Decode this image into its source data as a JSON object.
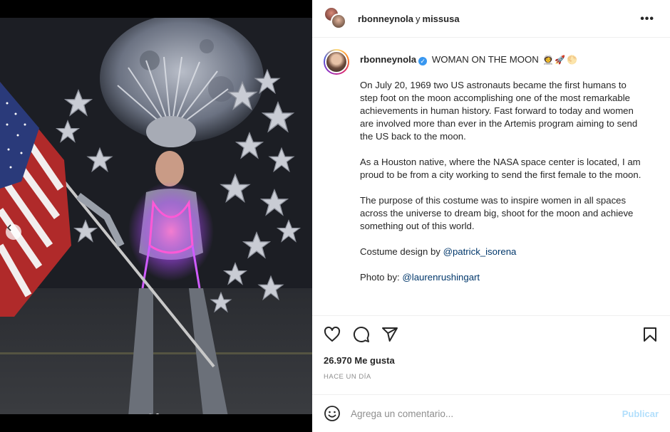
{
  "header": {
    "user1": "rbonneynola",
    "joiner": "y",
    "user2": "missusa",
    "more_label": "•••"
  },
  "caption": {
    "username": "rbonneynola",
    "verified_mark": "✓",
    "title": "WOMAN ON THE MOON",
    "emojis": [
      "👩‍🚀",
      "🚀",
      "🌕"
    ],
    "paragraphs": [
      "On July 20, 1969 two US astronauts became the first humans to step foot on the moon accomplishing one of the most remarkable achievements in human history. Fast forward to today and women are involved more than ever in the Artemis program aiming to send the US back to the moon.",
      "As a Houston native, where the NASA space center is located, I am proud to be from a city working to send the first female to the moon.",
      "The purpose of this costume was to inspire women in all spaces across the universe to dream big, shoot for the moon and achieve something out of this world."
    ],
    "design_prefix": "Costume design by ",
    "design_mention": "@patrick_isorena",
    "photo_prefix": "Photo by: ",
    "photo_mention": "@laurenrushingart"
  },
  "actions": {
    "icons": [
      "heart-icon",
      "comment-icon",
      "share-icon",
      "bookmark-icon"
    ]
  },
  "likes": "26.970 Me gusta",
  "timestamp": "HACE UN DÍA",
  "comment_box": {
    "placeholder": "Agrega un comentario...",
    "publish_label": "Publicar"
  },
  "carousel": {
    "total": 2,
    "active": 2
  },
  "colors": {
    "link": "#00376b",
    "publish_disabled": "#b2dffc",
    "verified": "#3897f0"
  }
}
